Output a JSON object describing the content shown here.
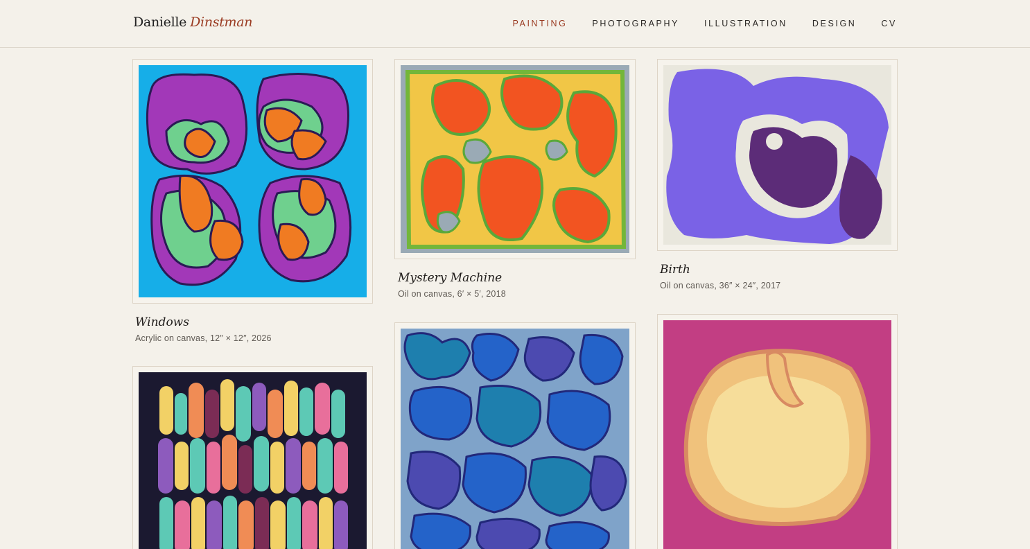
{
  "header": {
    "logo_first": "Danielle",
    "logo_last": "Dinstman",
    "nav": [
      {
        "label": "PAINTING",
        "active": true
      },
      {
        "label": "PHOTOGRAPHY",
        "active": false
      },
      {
        "label": "ILLUSTRATION",
        "active": false
      },
      {
        "label": "DESIGN",
        "active": false
      },
      {
        "label": "CV",
        "active": false
      }
    ]
  },
  "gallery": [
    {
      "title": "Windows",
      "meta": "Acrylic on canvas, 12″ × 12″, 2026"
    },
    {
      "title": "Mystery Machine",
      "meta": "Oil on canvas, 6′ × 5′, 2018"
    },
    {
      "title": "Birth",
      "meta": "Oil on canvas, 36″ × 24″, 2017"
    }
  ]
}
